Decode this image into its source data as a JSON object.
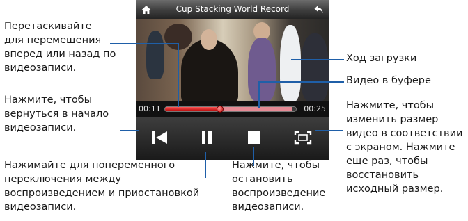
{
  "player": {
    "title": "Cup Stacking World Record",
    "time_elapsed": "00:11",
    "time_total": "00:25",
    "played_fraction": 0.42,
    "buffered_fraction": 0.97,
    "icons": [
      "home-icon",
      "back-arrow-icon",
      "skip-to-start-icon",
      "pause-icon",
      "stop-icon",
      "fullscreen-icon"
    ],
    "colors": {
      "accent": "#e02020",
      "line": "#1f5fa8"
    }
  },
  "callouts": {
    "drag": "Перетаскивайте\nдля перемещения\nвперед или назад по\nвидеозаписи.",
    "start": "Нажмите, чтобы\nвернуться в начало\nвидеозаписи.",
    "pause": "Нажимайте для попеременного\nпереключения между\nвоспроизведением и приостановкой\nвидеозаписи.",
    "stop": "Нажмите, чтобы\nостановить\nвоспроизведение\nвидеозаписи.",
    "download": "Ход загрузки",
    "buffer": "Видео в буфере",
    "resize": "Нажмите, чтобы\nизменить размер\nвидео в соответствии\nс экраном. Нажмите\nеще раз, чтобы\nвосстановить\nисходный размер."
  }
}
